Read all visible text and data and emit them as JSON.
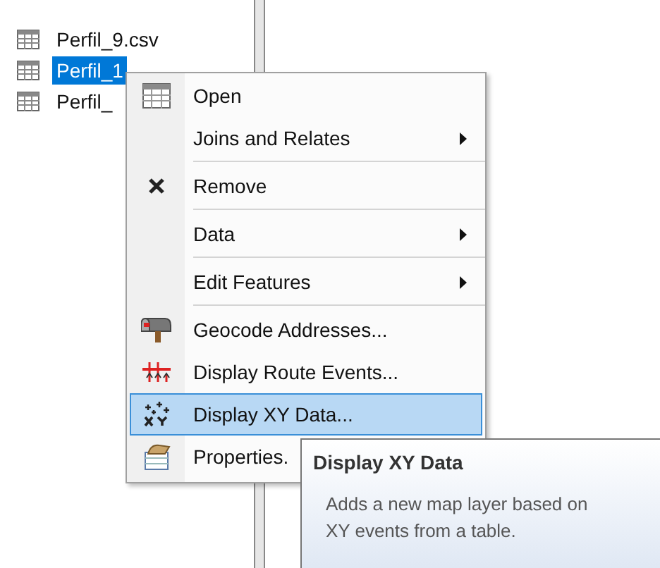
{
  "tree": {
    "items": [
      {
        "label": "Perfil_9.csv",
        "selected": false
      },
      {
        "label": "Perfil_1",
        "selected": true
      },
      {
        "label": "Perfil_",
        "selected": false
      }
    ]
  },
  "context_menu": {
    "items": [
      {
        "kind": "item",
        "label": "Open",
        "submenu": false,
        "selected": false
      },
      {
        "kind": "item",
        "label": "Joins and Relates",
        "submenu": true,
        "selected": false
      },
      {
        "kind": "separator"
      },
      {
        "kind": "item",
        "label": "Remove",
        "submenu": false,
        "selected": false
      },
      {
        "kind": "separator"
      },
      {
        "kind": "item",
        "label": "Data",
        "submenu": true,
        "selected": false
      },
      {
        "kind": "separator"
      },
      {
        "kind": "item",
        "label": "Edit Features",
        "submenu": true,
        "selected": false
      },
      {
        "kind": "separator"
      },
      {
        "kind": "item",
        "label": "Geocode Addresses...",
        "submenu": false,
        "selected": false
      },
      {
        "kind": "item",
        "label": "Display Route Events...",
        "submenu": false,
        "selected": false
      },
      {
        "kind": "item",
        "label": "Display XY Data...",
        "submenu": false,
        "selected": true
      },
      {
        "kind": "item",
        "label": "Properties.",
        "selected": false
      }
    ]
  },
  "tooltip": {
    "title": "Display XY Data",
    "text": "Adds a new map layer based on XY events from a table."
  }
}
